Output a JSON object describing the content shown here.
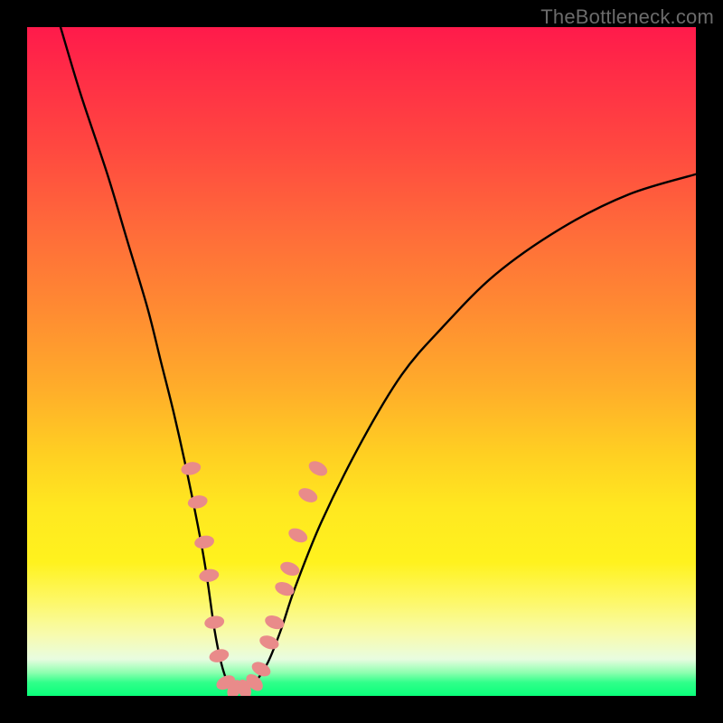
{
  "watermark": "TheBottleneck.com",
  "chart_data": {
    "type": "line",
    "title": "",
    "xlabel": "",
    "ylabel": "",
    "xlim": [
      0,
      100
    ],
    "ylim": [
      0,
      100
    ],
    "grid": false,
    "legend": false,
    "series": [
      {
        "name": "bottleneck-curve",
        "x": [
          5,
          8,
          12,
          15,
          18,
          20,
          22,
          24,
          26,
          27,
          28,
          29,
          30,
          31,
          32,
          34,
          36,
          38,
          40,
          44,
          50,
          56,
          62,
          70,
          80,
          90,
          100
        ],
        "y": [
          100,
          90,
          78,
          68,
          58,
          50,
          42,
          33,
          23,
          17,
          10,
          5,
          2,
          1,
          1,
          2,
          5,
          10,
          16,
          26,
          38,
          48,
          55,
          63,
          70,
          75,
          78
        ]
      }
    ],
    "markers": {
      "name": "highlight-points",
      "shape": "rounded-ellipse",
      "color": "#e98b8a",
      "points": [
        {
          "x": 24.5,
          "y": 34
        },
        {
          "x": 25.5,
          "y": 29
        },
        {
          "x": 26.5,
          "y": 23
        },
        {
          "x": 27.2,
          "y": 18
        },
        {
          "x": 28.0,
          "y": 11
        },
        {
          "x": 28.7,
          "y": 6
        },
        {
          "x": 29.7,
          "y": 2
        },
        {
          "x": 31.0,
          "y": 1
        },
        {
          "x": 32.5,
          "y": 1
        },
        {
          "x": 34.0,
          "y": 2
        },
        {
          "x": 35.0,
          "y": 4
        },
        {
          "x": 36.2,
          "y": 8
        },
        {
          "x": 37.0,
          "y": 11
        },
        {
          "x": 38.5,
          "y": 16
        },
        {
          "x": 39.3,
          "y": 19
        },
        {
          "x": 40.5,
          "y": 24
        },
        {
          "x": 42.0,
          "y": 30
        },
        {
          "x": 43.5,
          "y": 34
        }
      ]
    },
    "background": {
      "type": "vertical-gradient",
      "stops": [
        {
          "pos": 0,
          "color": "#ff1a4b"
        },
        {
          "pos": 50,
          "color": "#ffad2a"
        },
        {
          "pos": 80,
          "color": "#fff21e"
        },
        {
          "pos": 100,
          "color": "#0aff7a"
        }
      ]
    }
  }
}
